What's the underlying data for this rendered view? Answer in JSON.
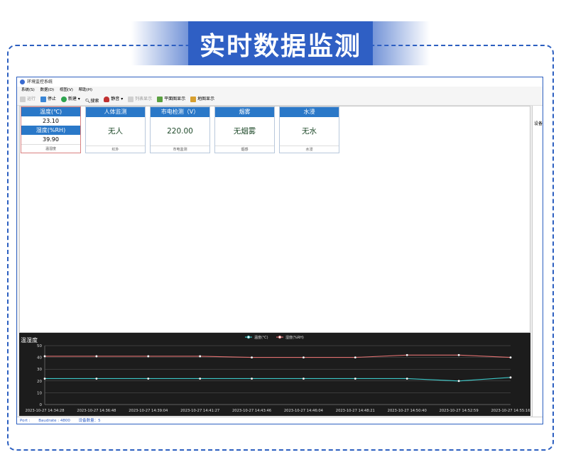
{
  "banner": {
    "title": "实时数据监测"
  },
  "window": {
    "title": "环境监控系统"
  },
  "menu": [
    "系统(S)",
    "数据(D)",
    "视图(V)",
    "帮助(H)"
  ],
  "toolbar": {
    "run": "运行",
    "stop": "停止",
    "new": "新建",
    "search": "搜索",
    "mute": "静音",
    "list": "列表显示",
    "plan": "平面图显示",
    "map": "地图显示"
  },
  "cards": {
    "th": {
      "temp_label": "温度(℃)",
      "temp_value": "23.10",
      "hum_label": "湿度(%RH)",
      "hum_value": "39.90",
      "footer": "温湿度"
    },
    "body": {
      "title": "人体监测",
      "value": "无人",
      "footer": "红外"
    },
    "power": {
      "title": "市电检测（V）",
      "value": "220.00",
      "footer": "市电监测"
    },
    "smoke": {
      "title": "烟雾",
      "value": "无烟雾",
      "footer": "烟感"
    },
    "water": {
      "title": "水浸",
      "value": "无水",
      "footer": "水浸"
    }
  },
  "right_panel": {
    "label": "设备"
  },
  "chart_data": {
    "type": "line",
    "title": "温湿度",
    "legend": [
      "温度(℃)",
      "湿度(%RH)"
    ],
    "legend_position": "top-center",
    "ylim": [
      0,
      50
    ],
    "yticks": [
      0,
      10,
      20,
      30,
      40,
      50
    ],
    "grid": true,
    "x": [
      "2023-10-27 14:34:28",
      "2023-10-27 14:36:48",
      "2023-10-27 14:39:04",
      "2023-10-27 14:41:27",
      "2023-10-27 14:43:46",
      "2023-10-27 14:46:04",
      "2023-10-27 14:48:21",
      "2023-10-27 14:50:40",
      "2023-10-27 14:52:59",
      "2023-10-27 14:55:16"
    ],
    "series": [
      {
        "name": "温度(℃)",
        "color": "#3cc8c8",
        "values": [
          22,
          22,
          22,
          22,
          22,
          22,
          22,
          22,
          20,
          23
        ]
      },
      {
        "name": "湿度(%RH)",
        "color": "#e07070",
        "values": [
          41,
          41,
          41,
          41,
          40,
          40,
          40,
          42,
          42,
          40
        ]
      }
    ]
  },
  "status": {
    "port": "Port :",
    "baud": "Baudrate : 4800",
    "devices": "设备数量：5"
  }
}
